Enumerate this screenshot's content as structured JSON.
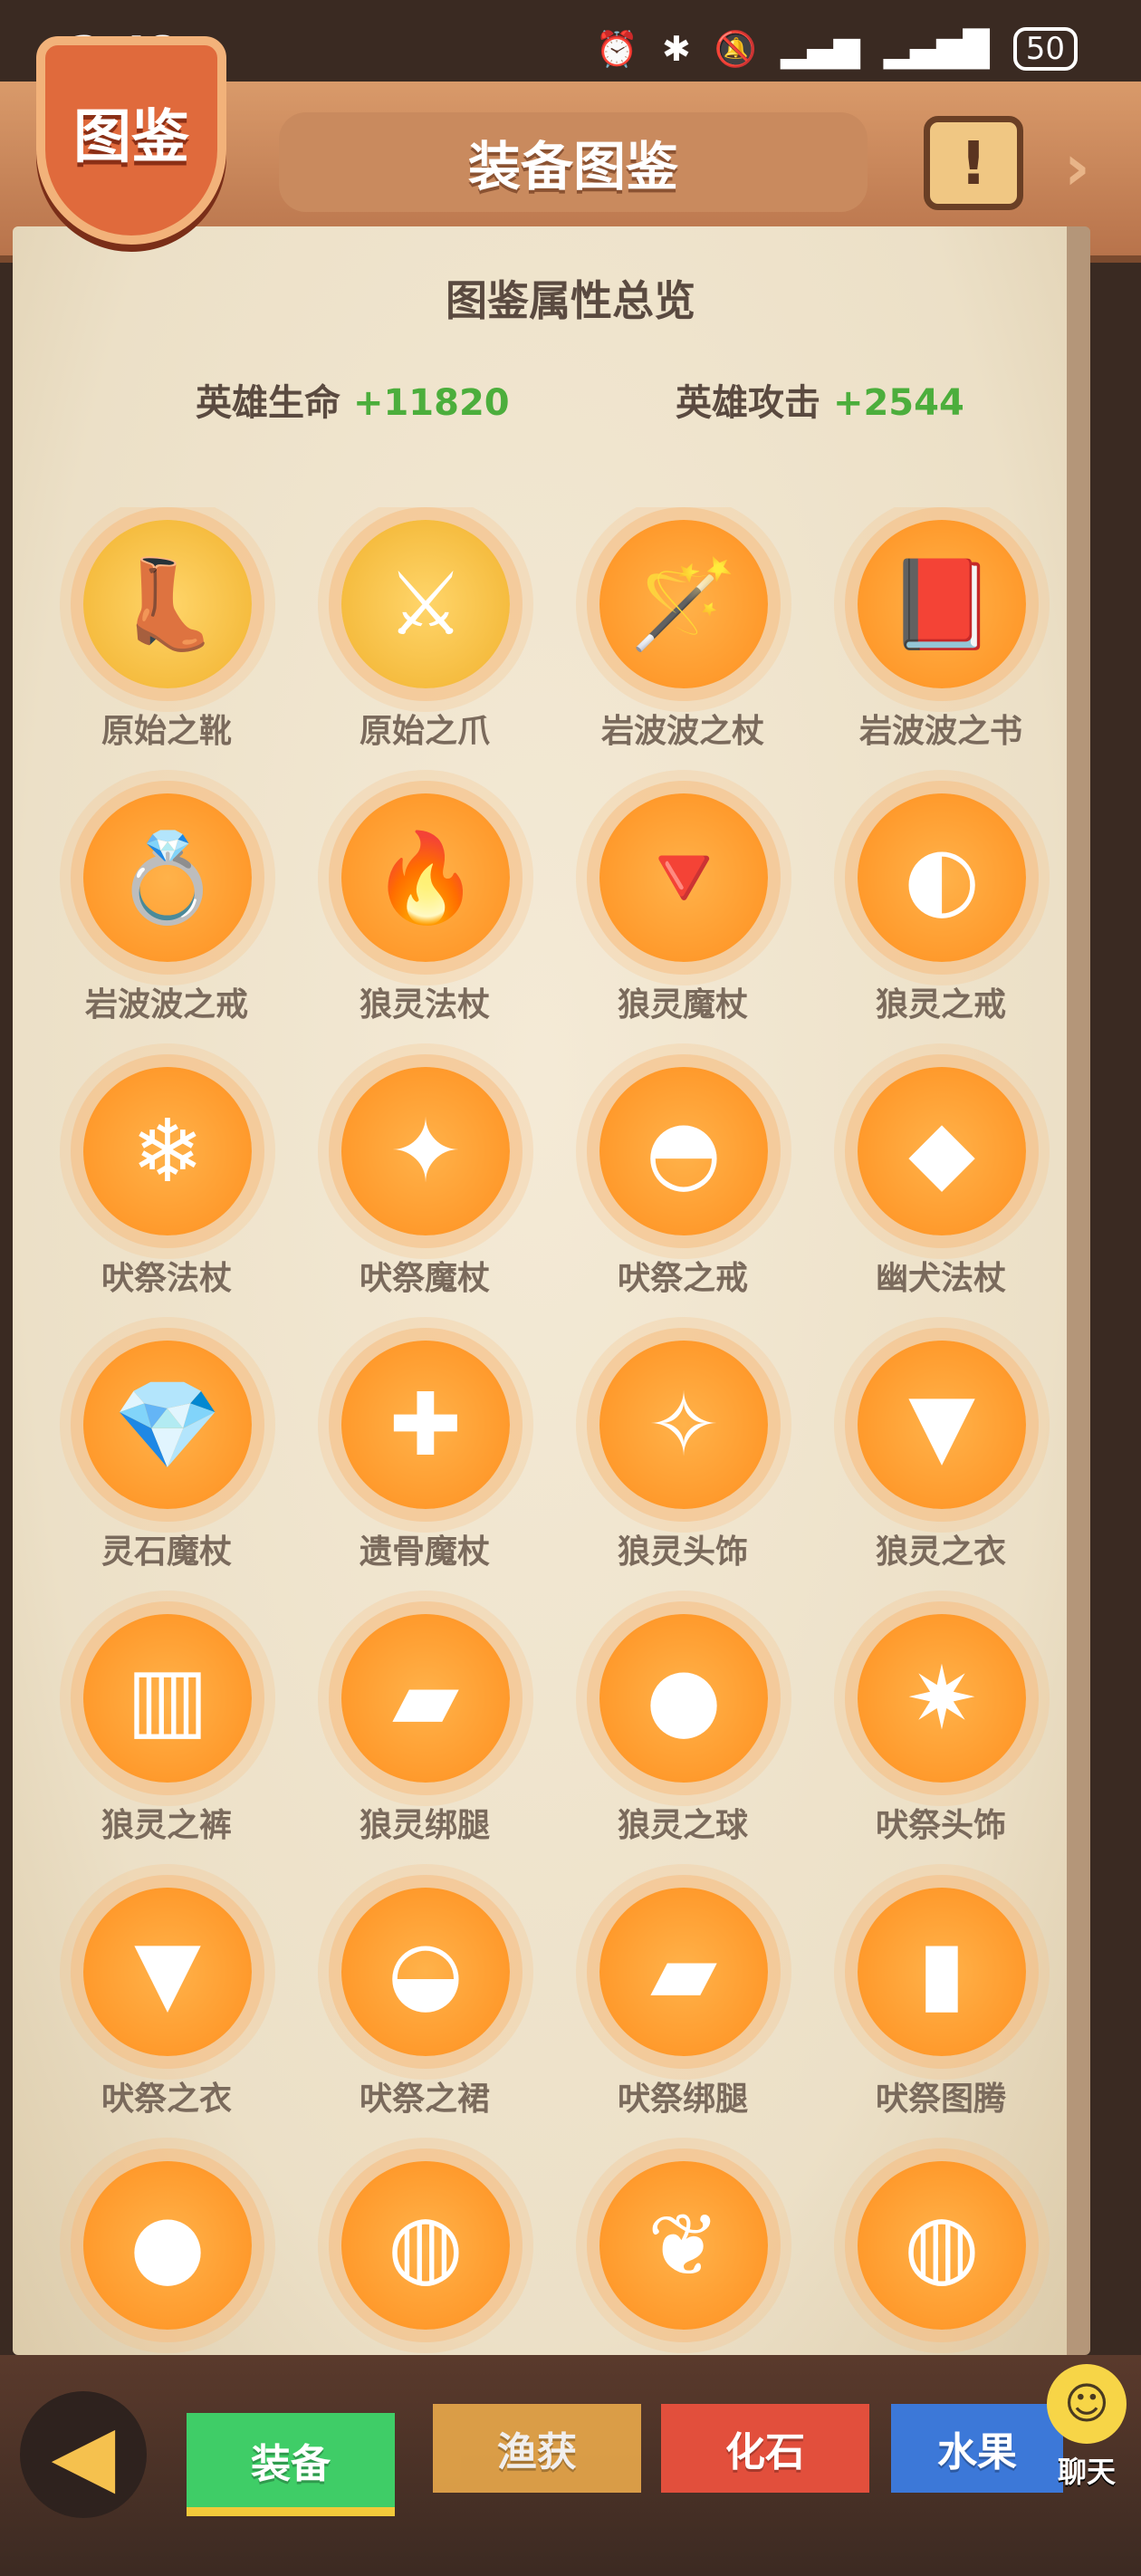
{
  "status_bar": {
    "time": "3:48",
    "battery": "50"
  },
  "header": {
    "badge": "图鉴",
    "title": "装备图鉴",
    "scroll_icon": "!",
    "next_icon": "›"
  },
  "overview": {
    "title": "图鉴属性总览",
    "hp_label": "英雄生命",
    "hp_value": "+11820",
    "atk_label": "英雄攻击",
    "atk_value": "+2544"
  },
  "items": [
    {
      "name": "原始之靴",
      "icon": "boot-icon",
      "glyph": "👢",
      "gold": true
    },
    {
      "name": "原始之爪",
      "icon": "claw-icon",
      "glyph": "⚔",
      "gold": true
    },
    {
      "name": "岩波波之杖",
      "icon": "staff-icon",
      "glyph": "🪄"
    },
    {
      "name": "岩波波之书",
      "icon": "book-icon",
      "glyph": "📕"
    },
    {
      "name": "岩波波之戒",
      "icon": "ring-icon",
      "glyph": "💍"
    },
    {
      "name": "狼灵法杖",
      "icon": "staff-icon",
      "glyph": "🔥"
    },
    {
      "name": "狼灵魔杖",
      "icon": "wand-icon",
      "glyph": "🔻"
    },
    {
      "name": "狼灵之戒",
      "icon": "ring-icon",
      "glyph": "◐"
    },
    {
      "name": "吠祭法杖",
      "icon": "staff-icon",
      "glyph": "❄"
    },
    {
      "name": "吠祭魔杖",
      "icon": "wand-icon",
      "glyph": "✦"
    },
    {
      "name": "吠祭之戒",
      "icon": "ring-icon",
      "glyph": "◓"
    },
    {
      "name": "幽犬法杖",
      "icon": "staff-icon",
      "glyph": "◆"
    },
    {
      "name": "灵石魔杖",
      "icon": "wand-icon",
      "glyph": "💎"
    },
    {
      "name": "遗骨魔杖",
      "icon": "wand-icon",
      "glyph": "✚"
    },
    {
      "name": "狼灵头饰",
      "icon": "headpiece-icon",
      "glyph": "✧"
    },
    {
      "name": "狼灵之衣",
      "icon": "cloak-icon",
      "glyph": "▼"
    },
    {
      "name": "狼灵之裤",
      "icon": "pants-icon",
      "glyph": "▥"
    },
    {
      "name": "狼灵绑腿",
      "icon": "leggings-icon",
      "glyph": "▰"
    },
    {
      "name": "狼灵之球",
      "icon": "orb-icon",
      "glyph": "●"
    },
    {
      "name": "吠祭头饰",
      "icon": "headpiece-icon",
      "glyph": "✷"
    },
    {
      "name": "吠祭之衣",
      "icon": "cloak-icon",
      "glyph": "▼"
    },
    {
      "name": "吠祭之裙",
      "icon": "skirt-icon",
      "glyph": "◒"
    },
    {
      "name": "吠祭绑腿",
      "icon": "leggings-icon",
      "glyph": "▰"
    },
    {
      "name": "吠祭图腾",
      "icon": "totem-icon",
      "glyph": "▮"
    },
    {
      "name": "",
      "icon": "orb-icon",
      "glyph": "●"
    },
    {
      "name": "",
      "icon": "collar-icon",
      "glyph": "◍"
    },
    {
      "name": "",
      "icon": "feather-icon",
      "glyph": "❦"
    },
    {
      "name": "",
      "icon": "collar-icon",
      "glyph": "◍"
    }
  ],
  "tabs": {
    "equip": "装备",
    "fish": "渔获",
    "fossil": "化石",
    "fruit": "水果"
  },
  "chat": {
    "label": "聊天"
  },
  "colors": {
    "accent": "#ff9a2c",
    "positive": "#4cae3c",
    "tab_equip": "#3fcd67",
    "tab_fossil": "#e24f3c",
    "tab_fruit": "#3c78d8",
    "tab_fish": "#e6a64a"
  }
}
